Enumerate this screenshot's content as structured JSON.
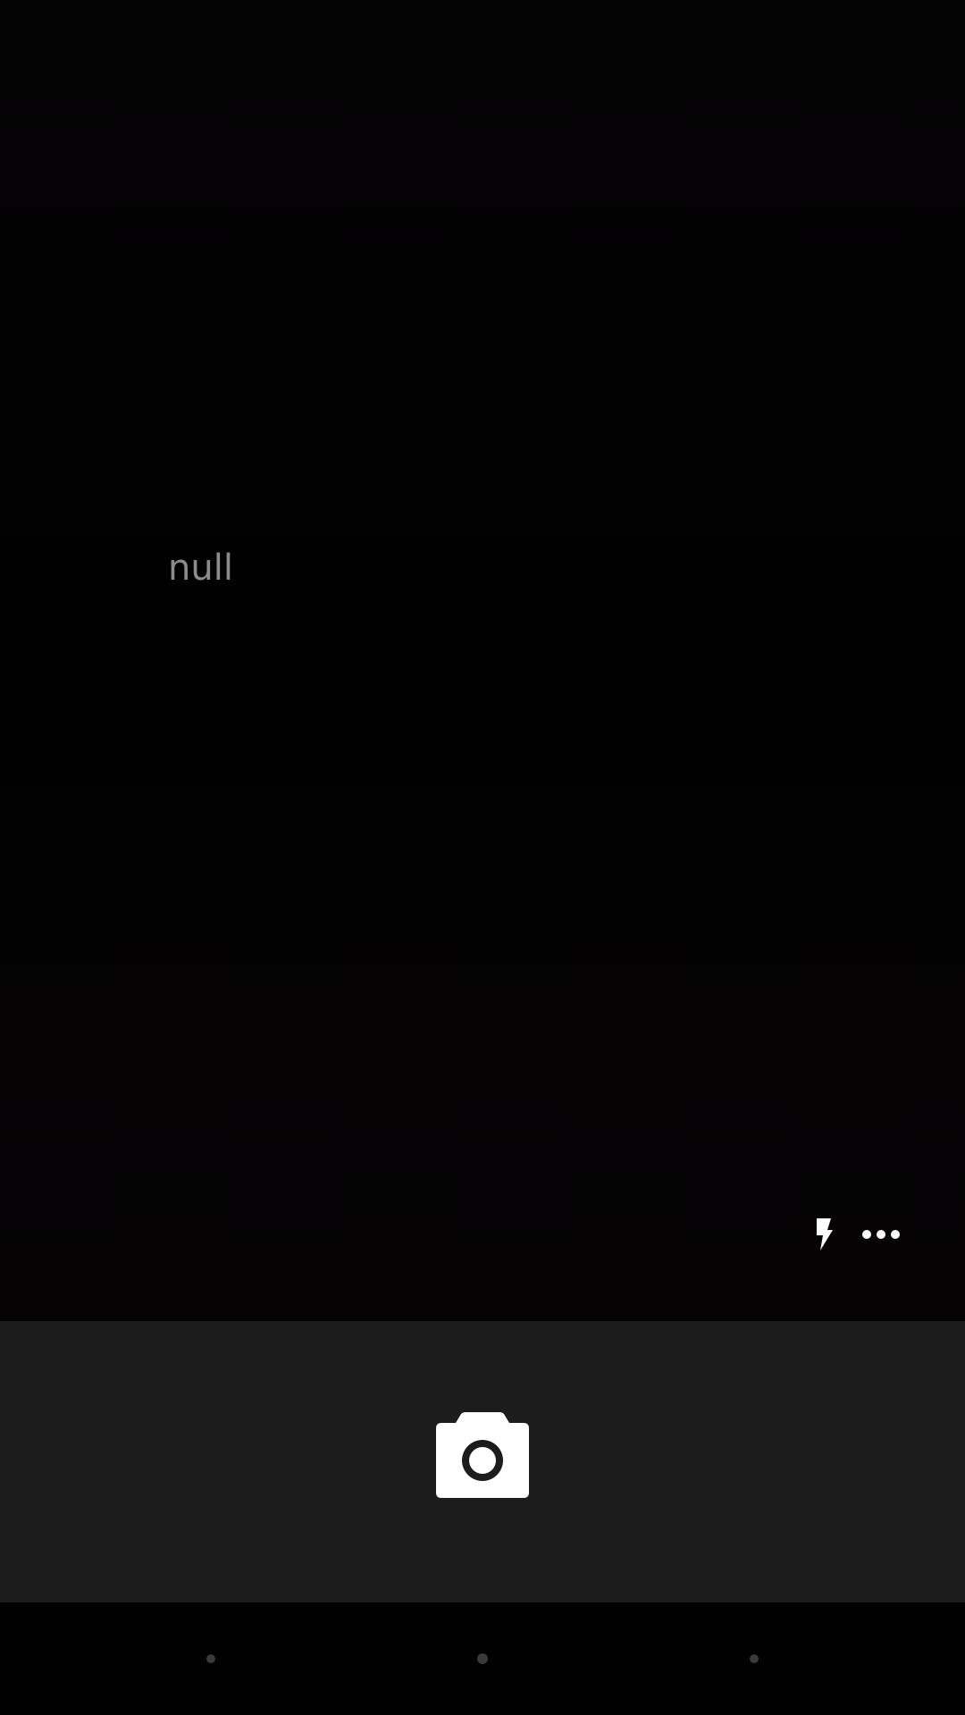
{
  "viewfinder": {
    "placeholder_text": "null"
  },
  "controls": {
    "flash_icon": "flash-icon",
    "more_icon": "more-horizontal-icon",
    "shutter_icon": "camera-icon"
  },
  "nav_bar": {
    "back_icon": "nav-back-dot",
    "home_icon": "nav-home-dot",
    "recent_icon": "nav-recent-dot"
  },
  "colors": {
    "viewfinder_bg": "#030203",
    "control_bar_bg": "#1c1c1c",
    "icon": "#ffffff",
    "placeholder_text": "#8c8c8c"
  }
}
